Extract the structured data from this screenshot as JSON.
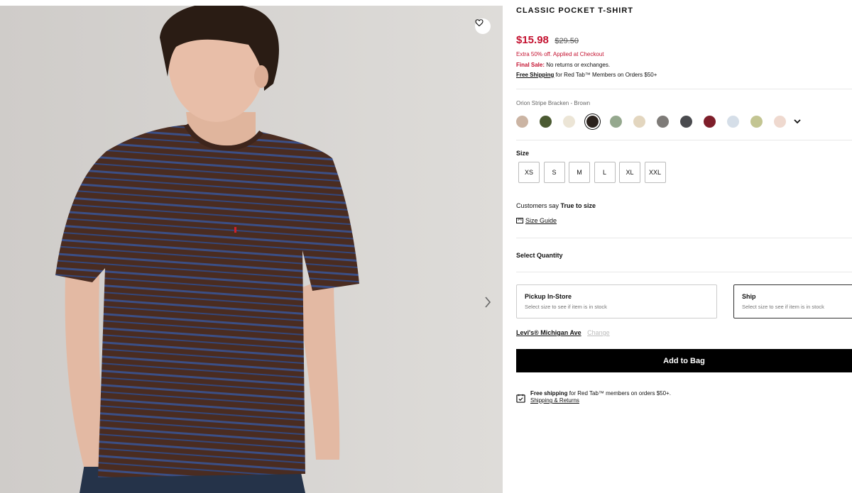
{
  "product": {
    "title": "CLASSIC POCKET T-SHIRT",
    "sale_price": "$15.98",
    "original_price": "$29.50",
    "promo_text": "Extra 50% off. Applied at Checkout",
    "final_sale_label": "Final Sale:",
    "final_sale_text": "No returns or exchanges.",
    "free_shipping_label": "Free Shipping",
    "free_shipping_text": "for Red Tab™ Members on Orders $50+"
  },
  "color": {
    "selected_name": "Orion Stripe Bracken - Brown",
    "swatches": [
      {
        "hex": "#cbb4a3"
      },
      {
        "hex": "#4b5a32"
      },
      {
        "hex": "#ece5d6"
      },
      {
        "hex": "#2b221d",
        "selected": true
      },
      {
        "hex": "#95a88e"
      },
      {
        "hex": "#e3d6bf"
      },
      {
        "hex": "#7e7b78"
      },
      {
        "hex": "#4a4b4f"
      },
      {
        "hex": "#7e1e2a"
      },
      {
        "hex": "#d5dee8"
      },
      {
        "hex": "#c3c592"
      },
      {
        "hex": "#efd9cf"
      }
    ]
  },
  "size": {
    "label": "Size",
    "options": [
      "XS",
      "S",
      "M",
      "L",
      "XL",
      "XXL"
    ]
  },
  "fit": {
    "prefix": "Customers say",
    "value": "True to size",
    "size_guide": "Size Guide"
  },
  "quantity": {
    "label": "Select Quantity"
  },
  "fulfillment": {
    "pickup_title": "Pickup In-Store",
    "pickup_sub": "Select size to see if item is in stock",
    "ship_title": "Ship",
    "ship_sub": "Select size to see if item is in stock"
  },
  "store": {
    "name": "Levi's® Michigan Ave",
    "change": "Change"
  },
  "actions": {
    "add_to_bag": "Add to Bag"
  },
  "shipping_info": {
    "label": "Free shipping",
    "text": "for Red Tab™ members on orders $50+.",
    "returns_link": "Shipping & Returns"
  },
  "icons": {
    "wishlist": "heart-icon",
    "next": "chevron-right-icon",
    "more_colors": "chevron-down-icon",
    "size_guide": "ruler-icon",
    "shipping": "calendar-check-icon"
  },
  "colors": {
    "sale_red": "#c41230",
    "button_black": "#000000"
  }
}
